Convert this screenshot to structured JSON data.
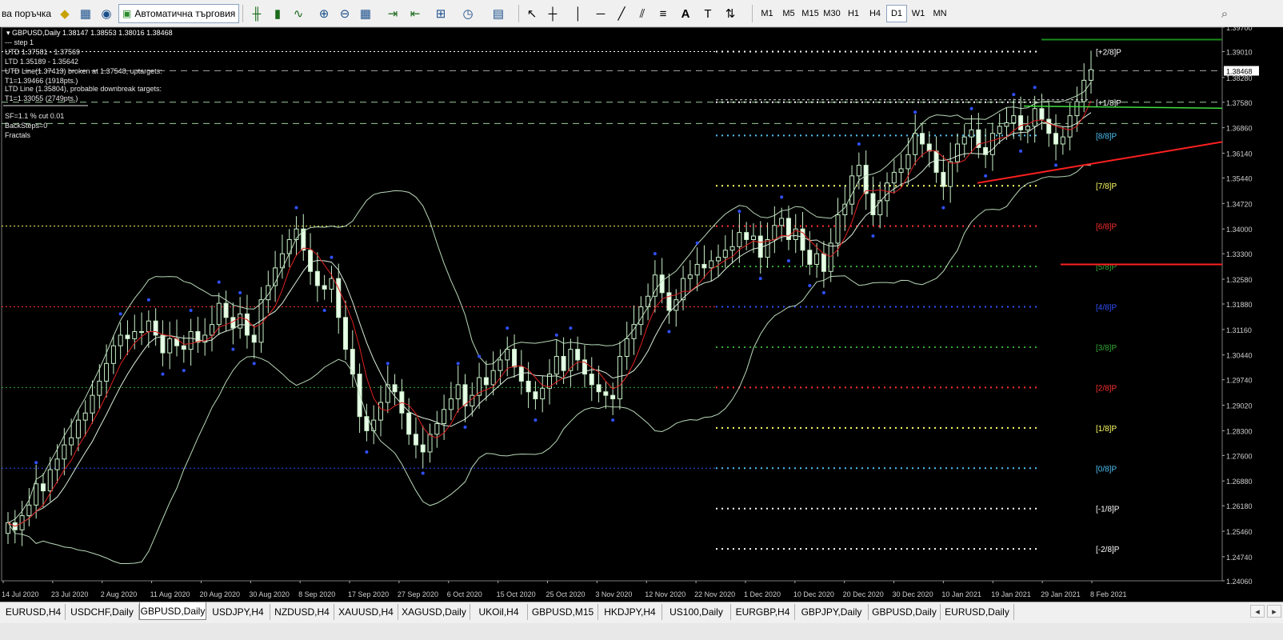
{
  "toolbar": {
    "new_order": "ва поръчка",
    "algo_trading": "Автоматична търговия",
    "timeframes": [
      "M1",
      "M5",
      "M15",
      "M30",
      "H1",
      "H4",
      "D1",
      "W1",
      "MN"
    ],
    "active_timeframe": "D1"
  },
  "chart": {
    "header": "GBPUSD,Daily  1.38147 1.38553 1.38016 1.38468",
    "info_lines": [
      "---   step 1",
      "UTD 1.37581 - 1.37569",
      "LTD  1.35189 - 1.35642",
      "UTD Line(1.37413) broken at 1.37548, uptargets:",
      "T1=1.39466 (1918pts.)",
      "LTD Line (1.35804), probable downbreak targets:",
      "T1=1.33055 (2749pts.)",
      "SF=1.1 % cut 0.01",
      "BackSteps=0",
      "Fractals"
    ],
    "price_labels": [
      "1.39700",
      "1.39010",
      "1.38468",
      "1.38280",
      "1.37580",
      "1.36860",
      "1.36140",
      "1.35440",
      "1.34720",
      "1.34000",
      "1.33300",
      "1.32580",
      "1.31880",
      "1.31160",
      "1.30440",
      "1.29740",
      "1.29020",
      "1.28300",
      "1.27600",
      "1.26880",
      "1.26180",
      "1.25460",
      "1.24740",
      "1.24060"
    ],
    "current_price": "1.38468",
    "date_labels": [
      "14 Jul 2020",
      "23 Jul 2020",
      "2 Aug 2020",
      "11 Aug 2020",
      "20 Aug 2020",
      "30 Aug 2020",
      "8 Sep 2020",
      "17 Sep 2020",
      "27 Sep 2020",
      "6 Oct 2020",
      "15 Oct 2020",
      "25 Oct 2020",
      "3 Nov 2020",
      "12 Nov 2020",
      "22 Nov 2020",
      "1 Dec 2020",
      "10 Dec 2020",
      "20 Dec 2020",
      "30 Dec 2020",
      "10 Jan 2021",
      "19 Jan 2021",
      "29 Jan 2021",
      "8 Feb 2021"
    ],
    "murrey_levels": [
      {
        "label": "[+2/8]P",
        "price": 1.3901,
        "color": "#ffffff"
      },
      {
        "label": "[+1/8]P",
        "price": 1.3758,
        "color": "#ffffff"
      },
      {
        "label": "[8/8]P",
        "price": 1.3664,
        "color": "#4fc3f7"
      },
      {
        "label": "[7/8]P",
        "price": 1.3522,
        "color": "#ffff66"
      },
      {
        "label": "[6/8]P",
        "price": 1.3408,
        "color": "#ff3030"
      },
      {
        "label": "[5/8]P",
        "price": 1.3294,
        "color": "#33aa33"
      },
      {
        "label": "[4/8]P",
        "price": 1.318,
        "color": "#3050ff"
      },
      {
        "label": "[3/8]P",
        "price": 1.3066,
        "color": "#33aa33"
      },
      {
        "label": "[2/8]P",
        "price": 1.2952,
        "color": "#ff3030"
      },
      {
        "label": "[1/8]P",
        "price": 1.2838,
        "color": "#ffff66"
      },
      {
        "label": "[0/8]P",
        "price": 1.2724,
        "color": "#4fc3f7"
      },
      {
        "label": "[-1/8]P",
        "price": 1.261,
        "color": "#ffffff"
      },
      {
        "label": "[-2/8]P",
        "price": 1.2496,
        "color": "#ffffff"
      }
    ]
  },
  "chart_data": {
    "type": "candlestick",
    "symbol": "GBPUSD",
    "timeframe": "Daily",
    "ylim": [
      1.2406,
      1.397
    ],
    "closes": [
      1.257,
      1.255,
      1.259,
      1.262,
      1.268,
      1.266,
      1.272,
      1.275,
      1.279,
      1.281,
      1.286,
      1.288,
      1.293,
      1.297,
      1.302,
      1.307,
      1.31,
      1.309,
      1.311,
      1.311,
      1.314,
      1.31,
      1.305,
      1.309,
      1.307,
      1.306,
      1.311,
      1.308,
      1.31,
      1.313,
      1.319,
      1.315,
      1.312,
      1.316,
      1.31,
      1.308,
      1.32,
      1.324,
      1.329,
      1.333,
      1.337,
      1.34,
      1.334,
      1.328,
      1.324,
      1.323,
      1.326,
      1.315,
      1.306,
      1.299,
      1.287,
      1.283,
      1.286,
      1.291,
      1.296,
      1.294,
      1.288,
      1.282,
      1.279,
      1.277,
      1.282,
      1.285,
      1.289,
      1.292,
      1.296,
      1.29,
      1.293,
      1.298,
      1.296,
      1.3,
      1.303,
      1.306,
      1.301,
      1.297,
      1.294,
      1.292,
      1.295,
      1.299,
      1.304,
      1.3,
      1.306,
      1.303,
      1.299,
      1.296,
      1.294,
      1.293,
      1.292,
      1.304,
      1.309,
      1.313,
      1.318,
      1.321,
      1.327,
      1.322,
      1.317,
      1.32,
      1.326,
      1.327,
      1.33,
      1.329,
      1.331,
      1.332,
      1.334,
      1.335,
      1.339,
      1.337,
      1.338,
      1.332,
      1.337,
      1.341,
      1.343,
      1.337,
      1.34,
      1.334,
      1.33,
      1.333,
      1.328,
      1.336,
      1.344,
      1.347,
      1.355,
      1.358,
      1.35,
      1.344,
      1.348,
      1.353,
      1.356,
      1.357,
      1.361,
      1.367,
      1.364,
      1.362,
      1.356,
      1.352,
      1.359,
      1.364,
      1.366,
      1.368,
      1.363,
      1.361,
      1.367,
      1.369,
      1.37,
      1.372,
      1.368,
      1.369,
      1.374,
      1.371,
      1.367,
      1.364,
      1.366,
      1.372,
      1.376,
      1.382,
      1.385
    ]
  },
  "tabs": [
    "EURUSD,H4",
    "USDCHF,Daily",
    "GBPUSD,Daily",
    "USDJPY,H4",
    "NZDUSD,H4",
    "XAUUSD,H4",
    "XAGUSD,Daily",
    "UKOil,H4",
    "GBPUSD,M15",
    "HKDJPY,H4",
    "US100,Daily",
    "EURGBP,H4",
    "GBPJPY,Daily",
    "GBPUSD,Daily",
    "EURUSD,Daily"
  ],
  "active_tab": 2
}
